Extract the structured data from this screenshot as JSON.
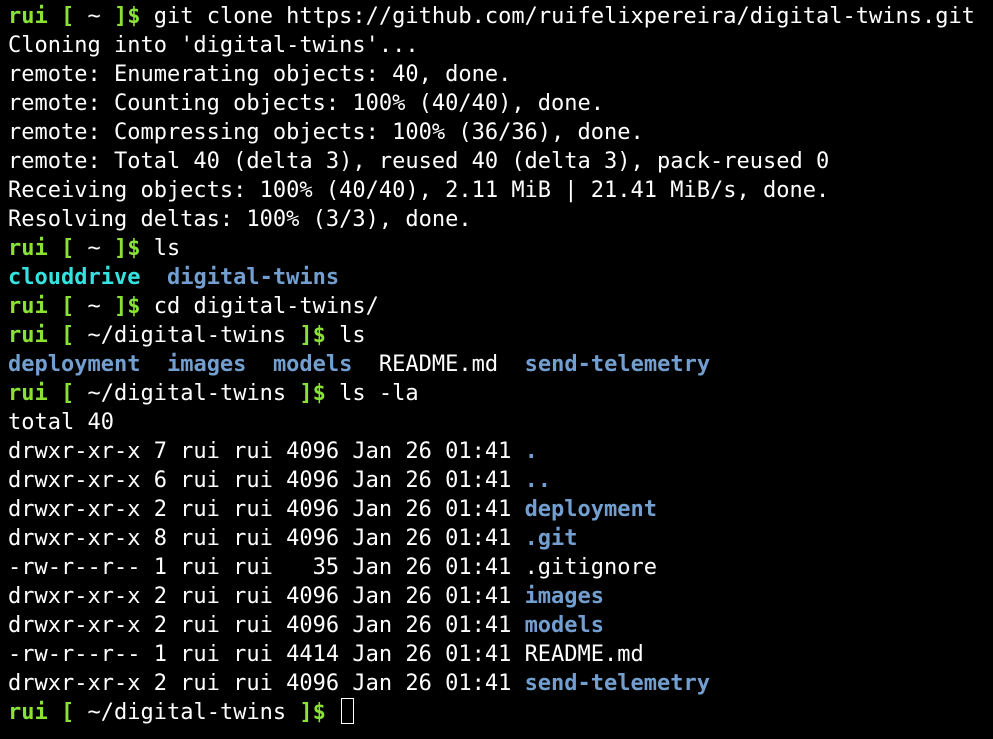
{
  "colors": {
    "background": "#000000",
    "text": "#ffffff",
    "prompt": "#8ae234",
    "dir_cyan": "#34e2e2",
    "dir_blue": "#729fcf"
  },
  "lines": [
    {
      "type": "prompt",
      "user": "rui",
      "path": "~",
      "command": "git clone https://github.com/ruifelixpereira/digital-twins.git"
    },
    {
      "type": "output",
      "text": "Cloning into 'digital-twins'..."
    },
    {
      "type": "output",
      "text": "remote: Enumerating objects: 40, done."
    },
    {
      "type": "output",
      "text": "remote: Counting objects: 100% (40/40), done."
    },
    {
      "type": "output",
      "text": "remote: Compressing objects: 100% (36/36), done."
    },
    {
      "type": "output",
      "text": "remote: Total 40 (delta 3), reused 40 (delta 3), pack-reused 0"
    },
    {
      "type": "output",
      "text": "Receiving objects: 100% (40/40), 2.11 MiB | 21.41 MiB/s, done."
    },
    {
      "type": "output",
      "text": "Resolving deltas: 100% (3/3), done."
    },
    {
      "type": "prompt",
      "user": "rui",
      "path": "~",
      "command": "ls"
    },
    {
      "type": "ls",
      "items": [
        {
          "name": "clouddrive",
          "style": "dir-cyan"
        },
        {
          "name": "digital-twins",
          "style": "dir-blue"
        }
      ]
    },
    {
      "type": "prompt",
      "user": "rui",
      "path": "~",
      "command": "cd digital-twins/"
    },
    {
      "type": "prompt",
      "user": "rui",
      "path": "~/digital-twins",
      "command": "ls"
    },
    {
      "type": "ls",
      "items": [
        {
          "name": "deployment",
          "style": "dir-blue"
        },
        {
          "name": "images",
          "style": "dir-blue"
        },
        {
          "name": "models",
          "style": "dir-blue"
        },
        {
          "name": "README.md",
          "style": "plain"
        },
        {
          "name": "send-telemetry",
          "style": "dir-blue"
        }
      ]
    },
    {
      "type": "prompt",
      "user": "rui",
      "path": "~/digital-twins",
      "command": "ls -la"
    },
    {
      "type": "output",
      "text": "total 40"
    },
    {
      "type": "entry",
      "meta": "drwxr-xr-x 7 rui rui 4096 Jan 26 01:41 ",
      "name": ".",
      "style": "dir-blue"
    },
    {
      "type": "entry",
      "meta": "drwxr-xr-x 6 rui rui 4096 Jan 26 01:41 ",
      "name": "..",
      "style": "dir-blue"
    },
    {
      "type": "entry",
      "meta": "drwxr-xr-x 2 rui rui 4096 Jan 26 01:41 ",
      "name": "deployment",
      "style": "dir-blue"
    },
    {
      "type": "entry",
      "meta": "drwxr-xr-x 8 rui rui 4096 Jan 26 01:41 ",
      "name": ".git",
      "style": "dir-blue"
    },
    {
      "type": "entry",
      "meta": "-rw-r--r-- 1 rui rui   35 Jan 26 01:41 ",
      "name": ".gitignore",
      "style": "plain"
    },
    {
      "type": "entry",
      "meta": "drwxr-xr-x 2 rui rui 4096 Jan 26 01:41 ",
      "name": "images",
      "style": "dir-blue"
    },
    {
      "type": "entry",
      "meta": "drwxr-xr-x 2 rui rui 4096 Jan 26 01:41 ",
      "name": "models",
      "style": "dir-blue"
    },
    {
      "type": "entry",
      "meta": "-rw-r--r-- 1 rui rui 4414 Jan 26 01:41 ",
      "name": "README.md",
      "style": "plain"
    },
    {
      "type": "entry",
      "meta": "drwxr-xr-x 2 rui rui 4096 Jan 26 01:41 ",
      "name": "send-telemetry",
      "style": "dir-blue"
    },
    {
      "type": "prompt",
      "user": "rui",
      "path": "~/digital-twins",
      "command": "",
      "cursor": true
    }
  ]
}
